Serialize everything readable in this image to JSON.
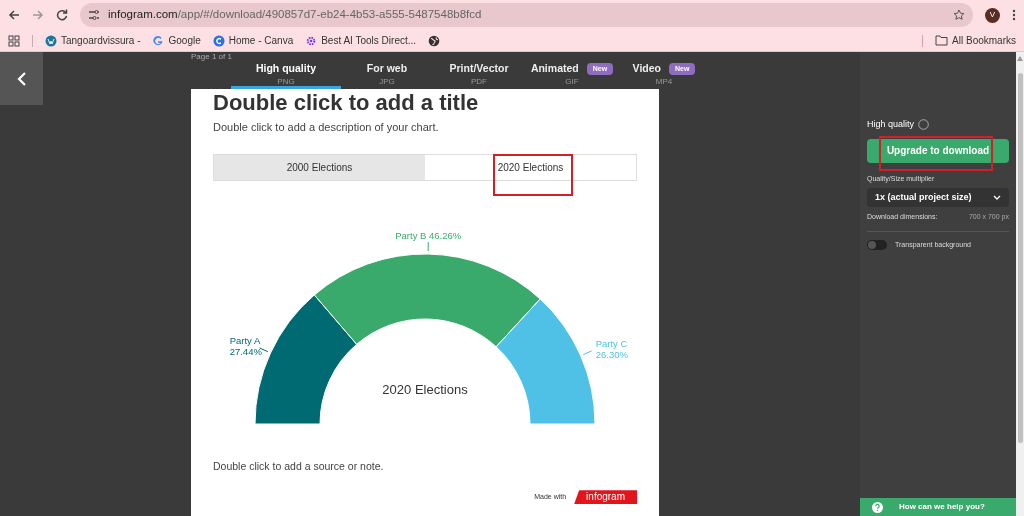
{
  "browser": {
    "url_host": "infogram.com",
    "url_path": "/app/#/download/490857d7-eb24-4b53-a555-5487548b8fcd",
    "profile_initial": "V",
    "bookmarks": [
      {
        "label": "Tangoardvissura -",
        "kind": "wp"
      },
      {
        "label": "Google",
        "kind": "google"
      },
      {
        "label": "Home - Canva",
        "kind": "canva"
      },
      {
        "label": "Best AI Tools Direct...",
        "kind": "gear"
      },
      {
        "kind": "globe"
      }
    ],
    "all_bookmarks": "All Bookmarks"
  },
  "export_tabs": [
    {
      "label": "High quality",
      "format": "PNG",
      "selected": true
    },
    {
      "label": "For web",
      "format": "JPG",
      "selected": false
    },
    {
      "label": "Print/Vector",
      "format": "PDF",
      "selected": false
    },
    {
      "label": "Animated",
      "format": "GIF",
      "badge": "New",
      "selected": false
    },
    {
      "label": "Video",
      "format": "MP4",
      "badge": "New",
      "selected": false
    }
  ],
  "page_label": "Page 1 of 1",
  "card": {
    "title": "Double click to add a title",
    "description": "Double click to add a description of your chart.",
    "tabs": [
      {
        "label": "2000 Elections",
        "selected": false
      },
      {
        "label": "2020 Elections",
        "selected": true
      }
    ],
    "chart_data": {
      "type": "donut",
      "categories": [
        "Party A",
        "Party B",
        "Party C"
      ],
      "series": [
        {
          "name": "2020 Elections",
          "values": [
            27.44,
            46.26,
            26.3
          ]
        }
      ],
      "value_labels": [
        "27.44%",
        "46.26%",
        "26.30%"
      ],
      "colors": [
        "#006a72",
        "#3aaa6c",
        "#4fc1e6"
      ]
    },
    "note": "Double click to add a source or note.",
    "made_with": "Made with",
    "brand": "infogram"
  },
  "panel": {
    "heading": "High quality",
    "upgrade": "Upgrade to download",
    "multiplier_label": "Quality/Size multiplier",
    "multiplier": "1x (actual project size)",
    "dimensions_label": "Download dimensions:",
    "dimensions": "700 x 700 px",
    "transparent_label": "Transparent background",
    "transparent": false
  },
  "help": "How can we help you?"
}
